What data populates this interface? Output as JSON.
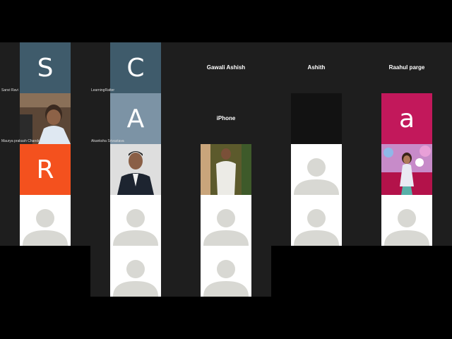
{
  "meeting": {
    "participants": [
      {
        "name": "Sanvi Ravi",
        "initial": "S",
        "color": "#3f5b6b"
      },
      {
        "name": "Maurya prakash Chandra"
      },
      {
        "name": "R",
        "initial": "R",
        "color": "#f4511e"
      },
      {
        "name": "LearningRatter",
        "initial": "C",
        "color": "#3f5b6b"
      },
      {
        "name": "Akanksha Srivastava",
        "initial": "A",
        "color": "#7c93a5"
      },
      {
        "name": "Gawali Ashish"
      },
      {
        "name": "iPhone"
      },
      {
        "name": "Ashith"
      },
      {
        "name": "Raahul parge",
        "initial": "a",
        "color": "#c2185b"
      }
    ]
  }
}
